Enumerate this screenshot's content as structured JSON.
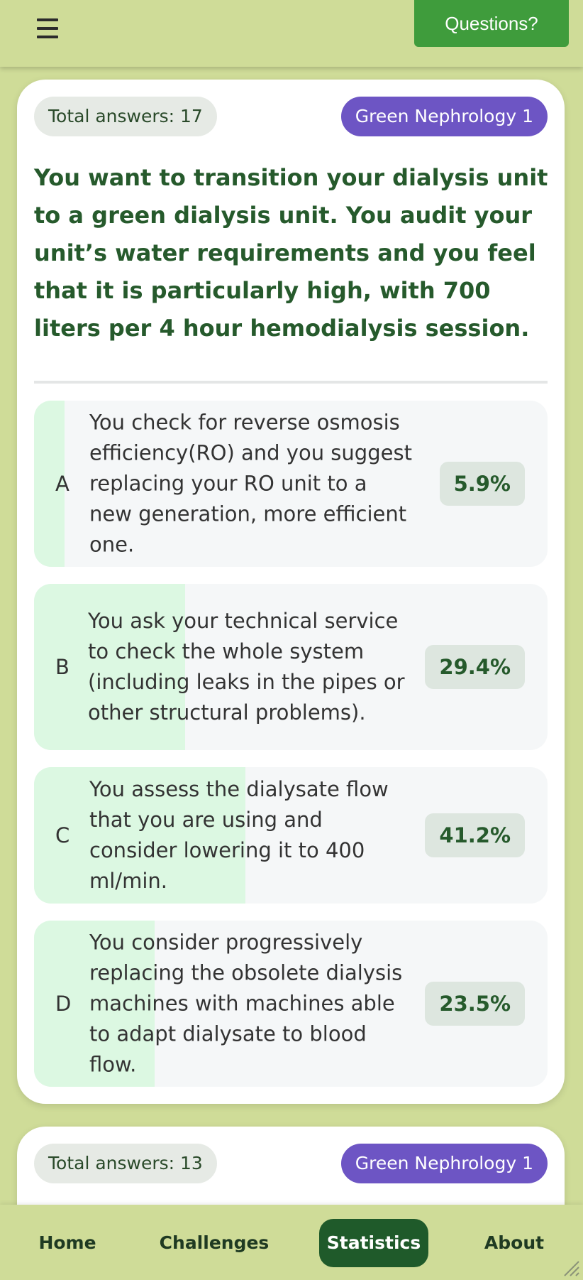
{
  "topbar": {
    "menu_icon": "hamburger-icon",
    "questions_label": "Questions?"
  },
  "cards": [
    {
      "total": "Total answers: 17",
      "topic": "Green Nephrology 1",
      "question": "You want to transition your dialysis unit to a green dialysis unit. You audit your unit’s water requirements and you feel that it is particularly high, with 700 liters per 4 hour hemodialysis session.",
      "options": [
        {
          "letter": "A",
          "text": "You check for reverse osmosis efficiency(RO) and you suggest replacing your RO unit to a new generation, more efficient one.",
          "percent": "5.9%",
          "share": 5.9
        },
        {
          "letter": "B",
          "text": "You ask your technical service to check the whole system (including leaks in the pipes or other structural problems).",
          "percent": "29.4%",
          "share": 29.4
        },
        {
          "letter": "C",
          "text": "You assess the dialysate flow that you are using and consider lowering it to 400 ml/min.",
          "percent": "41.2%",
          "share": 41.2
        },
        {
          "letter": "D",
          "text": "You consider progressively replacing the obsolete dialysis machines with machines able to adapt dialysate to blood flow.",
          "percent": "23.5%",
          "share": 23.5
        }
      ]
    },
    {
      "total": "Total answers: 13",
      "topic": "Green Nephrology 1"
    }
  ],
  "nav": {
    "home": "Home",
    "challenges": "Challenges",
    "statistics": "Statistics",
    "about": "About",
    "active": "statistics"
  },
  "colors": {
    "background": "#cfdc98",
    "accent_green": "#3f9c3c",
    "topic_purple": "#6d55c4",
    "fill_green": "#dcf8e2",
    "dark_green": "#265a2c"
  }
}
